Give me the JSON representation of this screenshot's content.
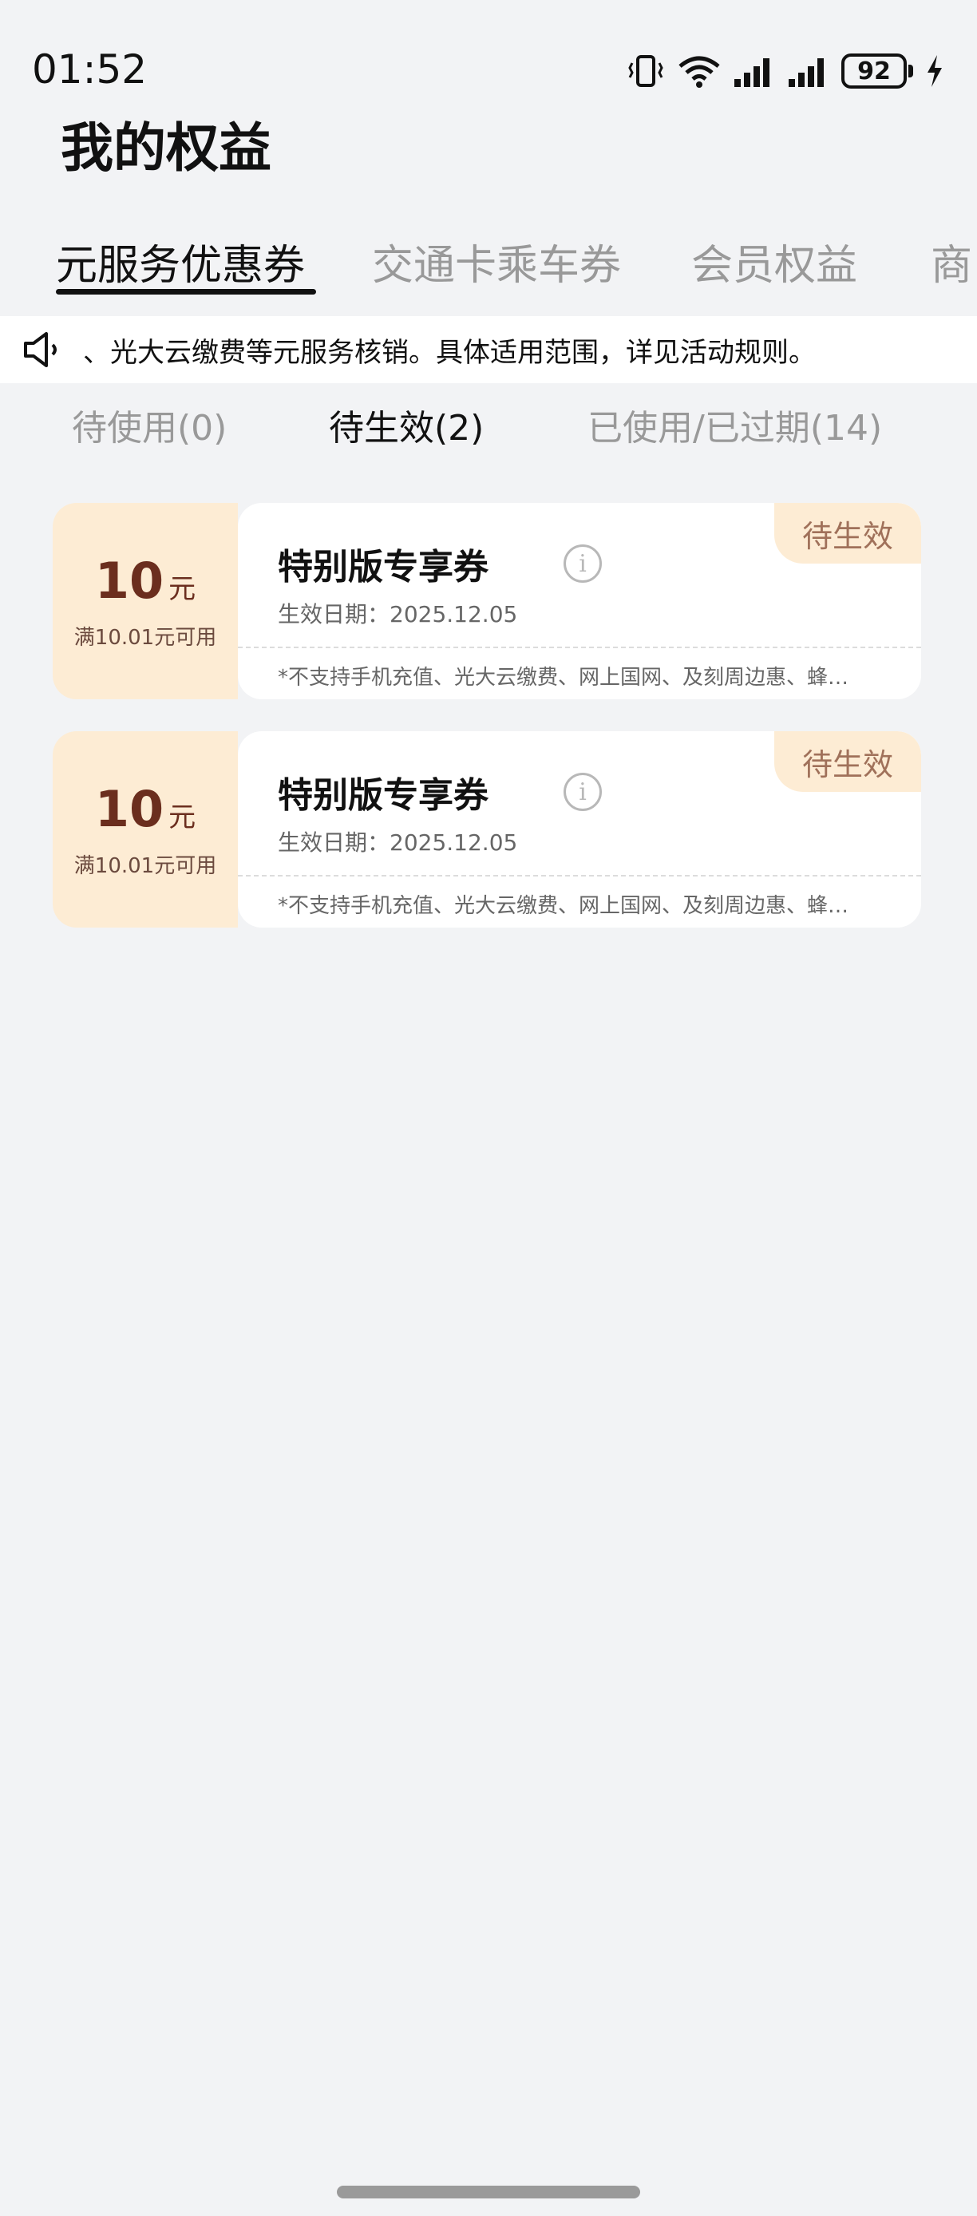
{
  "status_bar": {
    "time": "01:52",
    "battery": "92"
  },
  "page": {
    "title": "我的权益"
  },
  "main_tabs": [
    {
      "label": "元服务优惠券",
      "active": true
    },
    {
      "label": "交通卡乘车券",
      "active": false
    },
    {
      "label": "会员权益",
      "active": false
    },
    {
      "label": "商",
      "active": false
    }
  ],
  "notice": {
    "text": "、光大云缴费等元服务核销。具体适用范围，详见活动规则。"
  },
  "sub_tabs": [
    {
      "label": "待使用(0)",
      "active": false
    },
    {
      "label": "待生效(2)",
      "active": true
    },
    {
      "label": "已使用/已过期(14)",
      "active": false
    }
  ],
  "coupons": [
    {
      "amount": "10",
      "unit": "元",
      "threshold": "满10.01元可用",
      "name": "特别版专享券",
      "effective_date": "生效日期：2025.12.05",
      "restriction": "*不支持手机充值、光大云缴费、网上国网、及刻周边惠、蜂…",
      "status": "待生效"
    },
    {
      "amount": "10",
      "unit": "元",
      "threshold": "满10.01元可用",
      "name": "特别版专享券",
      "effective_date": "生效日期：2025.12.05",
      "restriction": "*不支持手机充值、光大云缴费、网上国网、及刻周边惠、蜂…",
      "status": "待生效"
    }
  ],
  "colors": {
    "background": "#f2f3f5",
    "coupon_accent": "#fdecd4",
    "amount_text": "#6b2e1e",
    "badge_text": "#a0715a"
  }
}
